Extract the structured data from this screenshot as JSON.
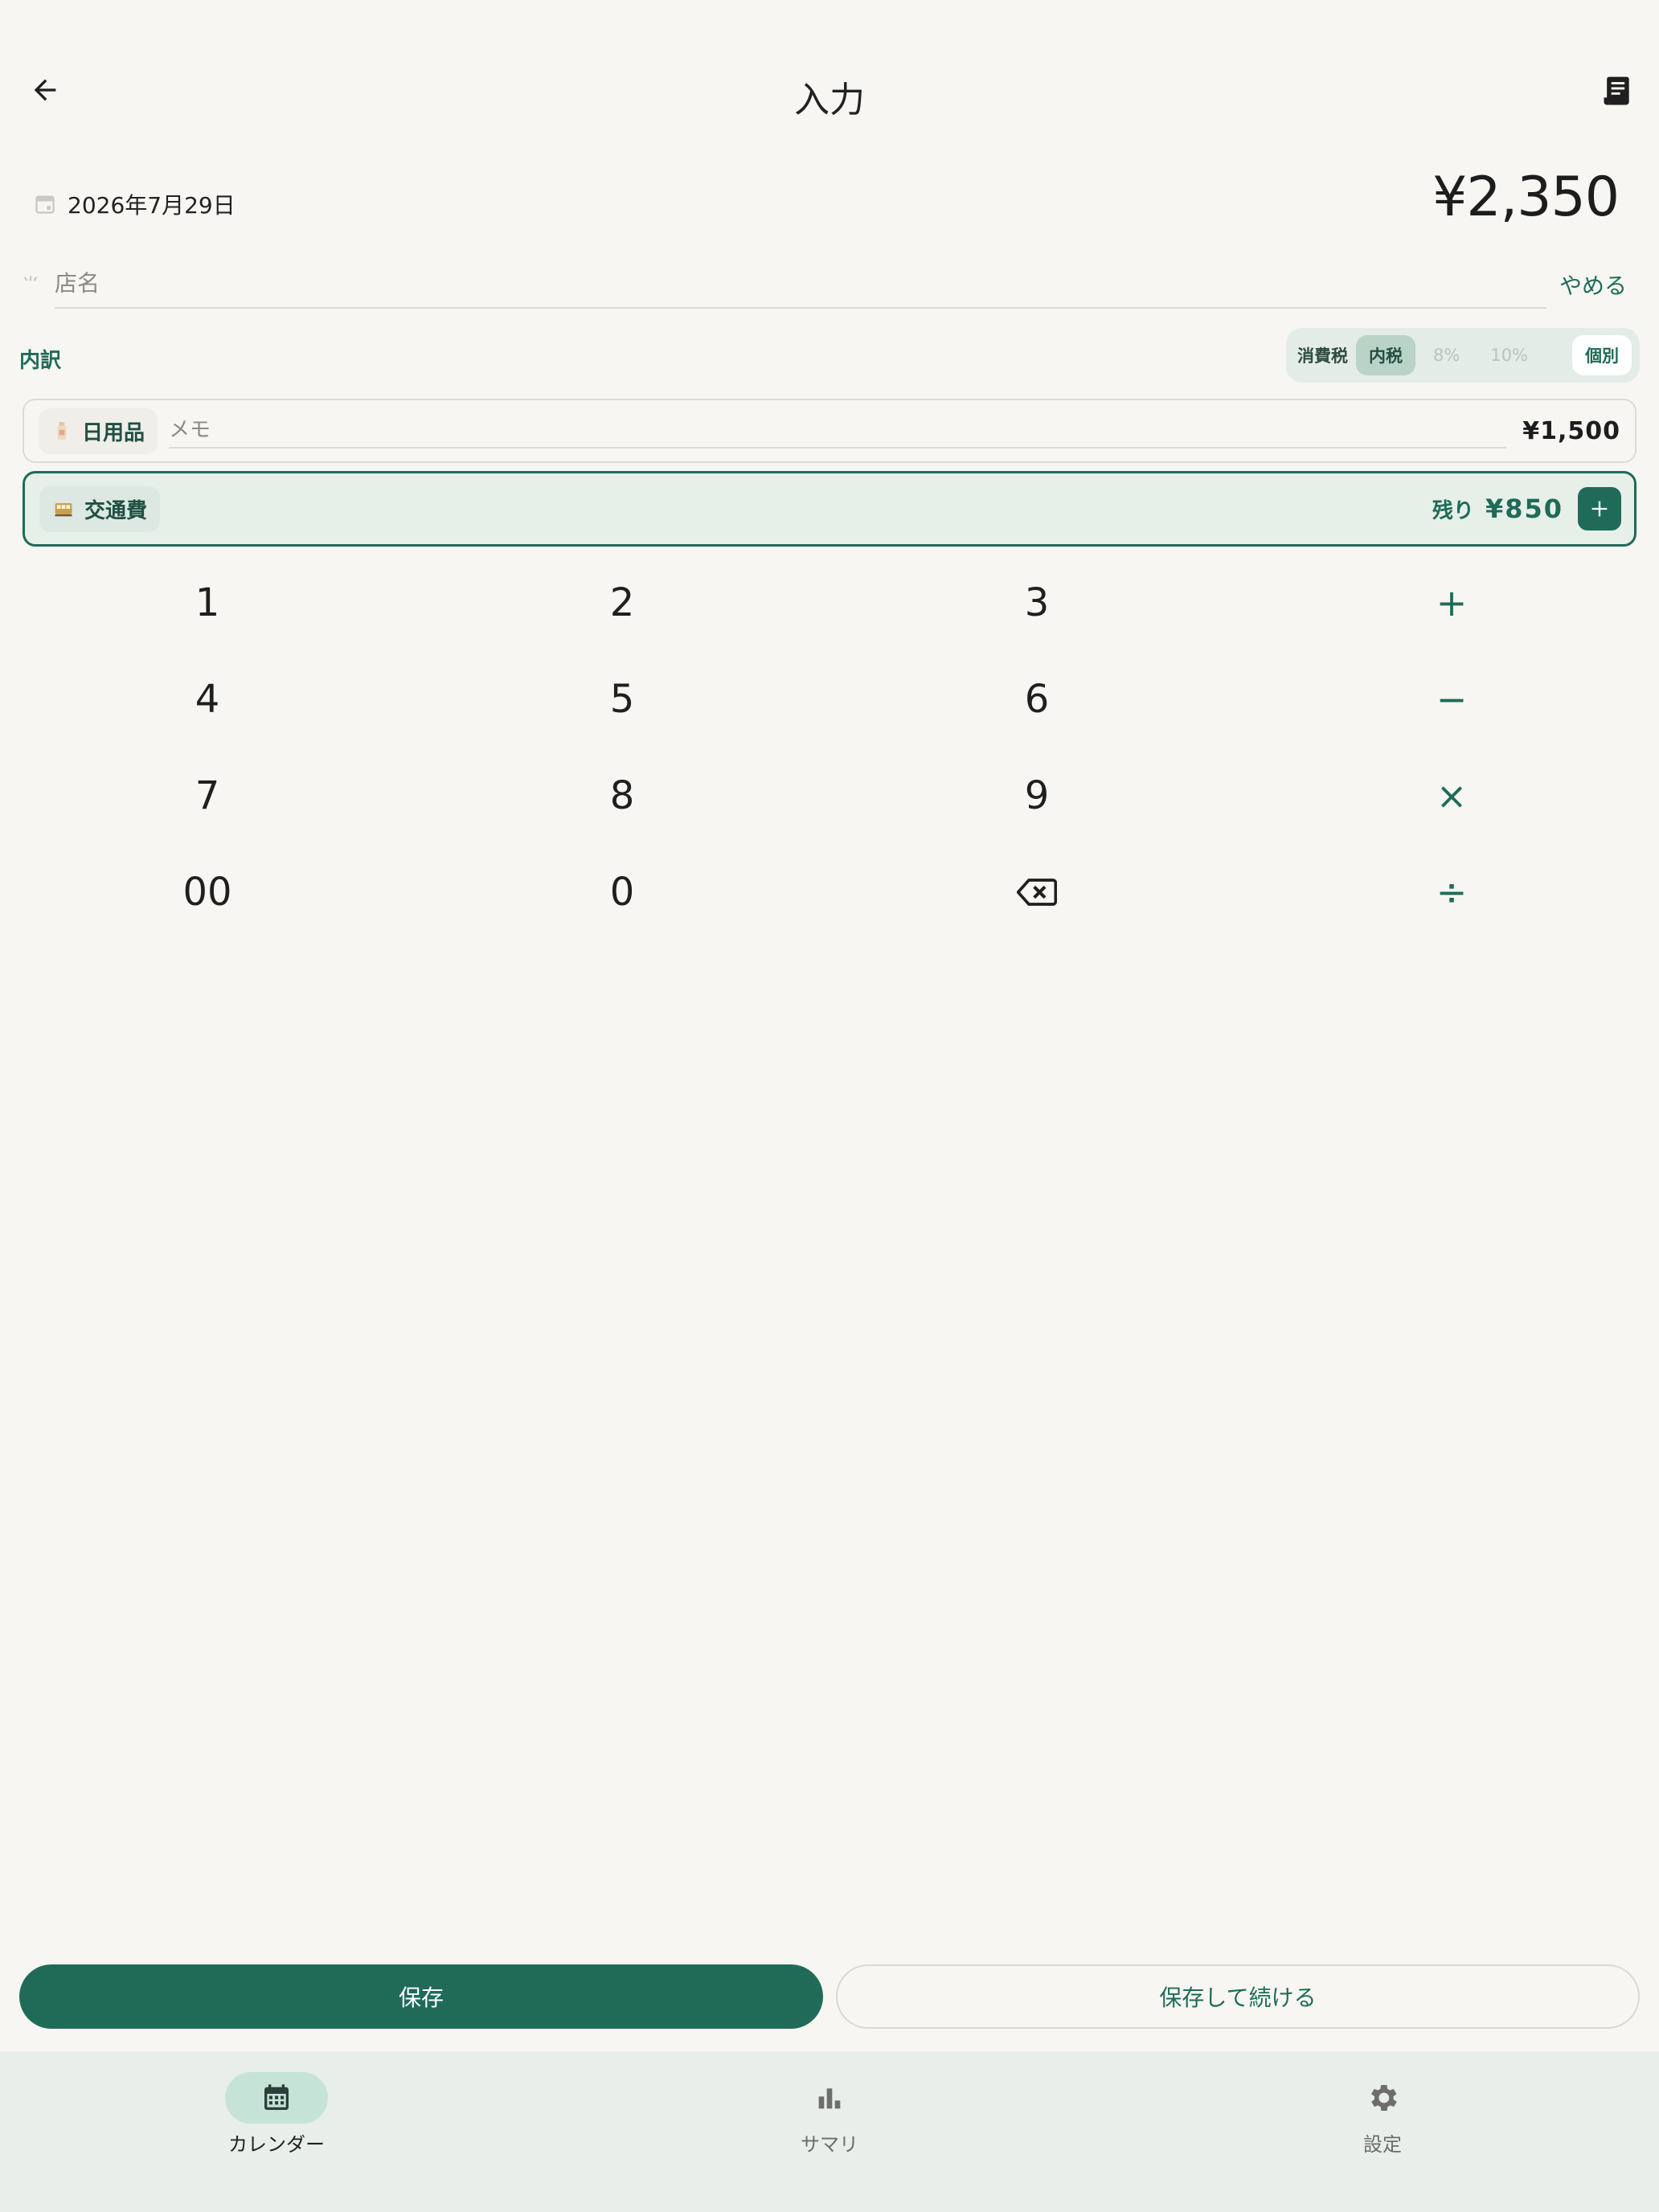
{
  "header": {
    "title": "入力",
    "back_icon": "arrow-left-icon",
    "receipt_icon": "receipt-icon"
  },
  "entry": {
    "date": "2026年7月29日",
    "total": "¥2,350",
    "store_placeholder": "店名",
    "cancel_label": "やめる"
  },
  "breakdown": {
    "label": "内訳",
    "tax": {
      "label": "消費税",
      "options": [
        "内税",
        "8%",
        "10%",
        "個別"
      ],
      "selected": "内税"
    },
    "items": [
      {
        "category": "日用品",
        "icon": "bottle-icon",
        "memo_placeholder": "メモ",
        "amount": "¥1,500"
      },
      {
        "category": "交通費",
        "icon": "train-icon",
        "remaining_label": "残り",
        "remaining_amount": "¥850"
      }
    ]
  },
  "keypad": {
    "keys": [
      "1",
      "2",
      "3",
      "+",
      "4",
      "5",
      "6",
      "−",
      "7",
      "8",
      "9",
      "×",
      "00",
      "0",
      "⌫",
      "÷"
    ]
  },
  "actions": {
    "save_label": "保存",
    "save_continue_label": "保存して続ける"
  },
  "nav": {
    "items": [
      {
        "label": "カレンダー",
        "icon": "calendar-icon",
        "active": true
      },
      {
        "label": "サマリ",
        "icon": "bar-chart-icon",
        "active": false
      },
      {
        "label": "設定",
        "icon": "gear-icon",
        "active": false
      }
    ]
  },
  "colors": {
    "accent": "#1f6b58",
    "background": "#f7f6f2",
    "nav_background": "#e8eee9"
  }
}
